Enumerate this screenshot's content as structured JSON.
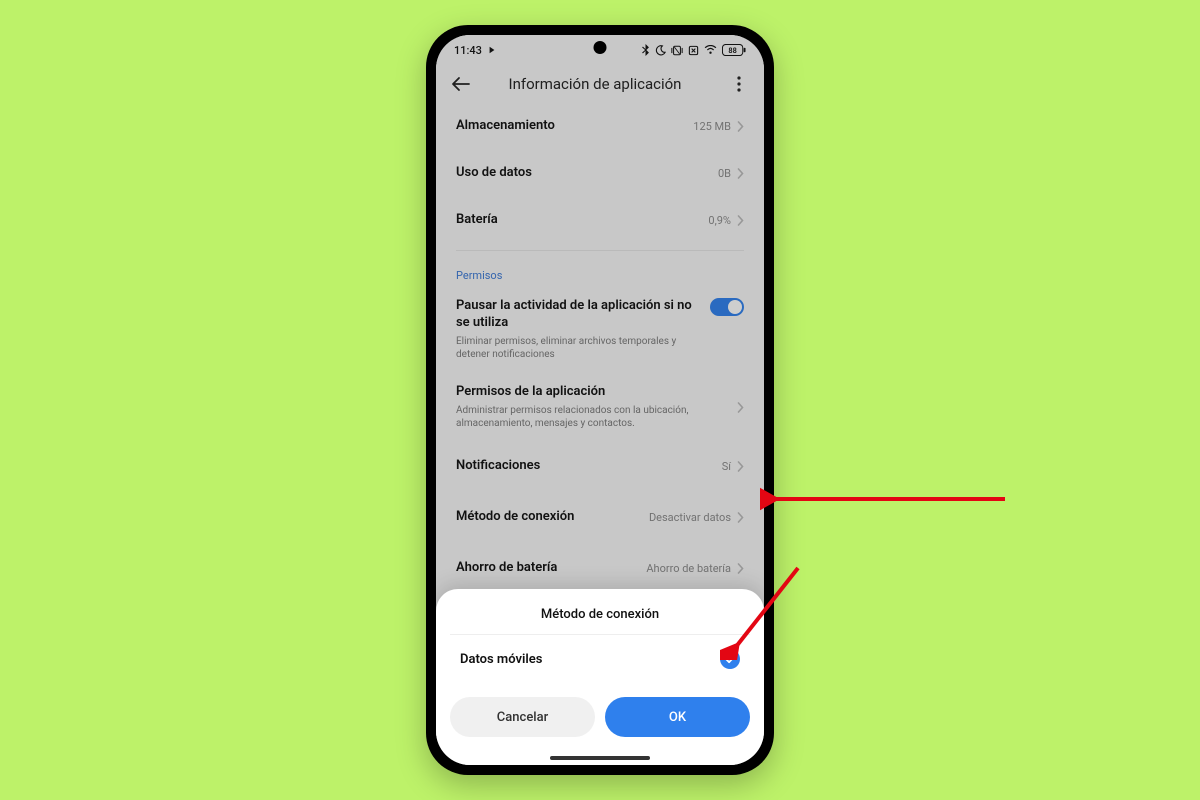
{
  "statusbar": {
    "time": "11:43",
    "battery": "88"
  },
  "header": {
    "title": "Información de aplicación"
  },
  "rows": {
    "storage": {
      "label": "Almacenamiento",
      "value": "125 MB"
    },
    "data": {
      "label": "Uso de datos",
      "value": "0B"
    },
    "battery": {
      "label": "Batería",
      "value": "0,9%"
    }
  },
  "sections": {
    "permissions": "Permisos"
  },
  "pause": {
    "label": "Pausar la actividad de la aplicación si no se utiliza",
    "sub": "Eliminar permisos, eliminar archivos temporales y detener notificaciones"
  },
  "appperms": {
    "label": "Permisos de la aplicación",
    "sub": "Administrar permisos relacionados con la ubicación, almacenamiento, mensajes y contactos."
  },
  "notifications": {
    "label": "Notificaciones",
    "value": "Sí"
  },
  "connection": {
    "label": "Método de conexión",
    "value": "Desactivar datos"
  },
  "batterysaver": {
    "label": "Ahorro de batería",
    "value": "Ahorro de batería"
  },
  "sheet": {
    "title": "Método de conexión",
    "option": "Datos móviles",
    "cancel": "Cancelar",
    "ok": "OK"
  }
}
